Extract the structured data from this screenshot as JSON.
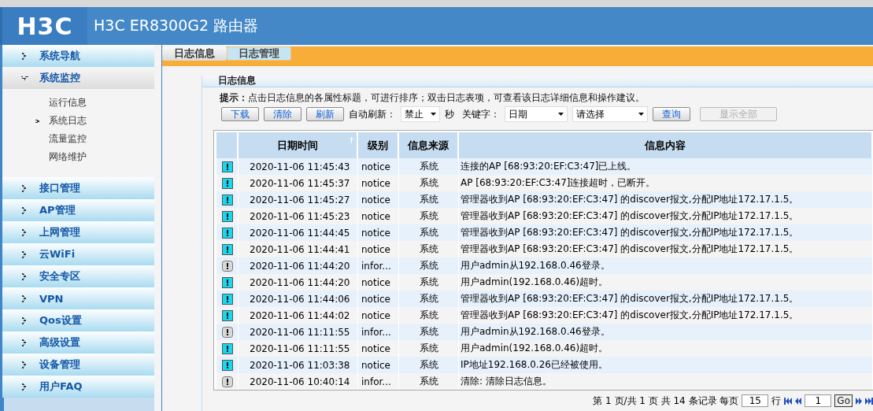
{
  "header": {
    "logo": "H3C",
    "title": "H3C ER8300G2 路由器"
  },
  "sidebar": {
    "items": [
      {
        "label": "系统导航",
        "expanded": false
      },
      {
        "label": "系统监控",
        "expanded": true,
        "children": [
          {
            "label": "运行信息",
            "selected": false
          },
          {
            "label": "系统日志",
            "selected": true
          },
          {
            "label": "流量监控",
            "selected": false
          },
          {
            "label": "网络维护",
            "selected": false
          }
        ]
      },
      {
        "label": "接口管理",
        "expanded": false
      },
      {
        "label": "AP管理",
        "expanded": false
      },
      {
        "label": "上网管理",
        "expanded": false
      },
      {
        "label": "云WiFi",
        "expanded": false
      },
      {
        "label": "安全专区",
        "expanded": false
      },
      {
        "label": "VPN",
        "expanded": false
      },
      {
        "label": "Qos设置",
        "expanded": false
      },
      {
        "label": "高级设置",
        "expanded": false
      },
      {
        "label": "设备管理",
        "expanded": false
      },
      {
        "label": "用户FAQ",
        "expanded": false
      }
    ]
  },
  "tabs": [
    {
      "label": "日志信息",
      "selected": true
    },
    {
      "label": "日志管理",
      "selected": false
    }
  ],
  "panel": {
    "title": "日志信息",
    "tip_label": "提示：",
    "tip": "点击日志信息的各属性标题，可进行排序；双击日志表项，可查看该日志详细信息和操作建议。",
    "buttons": [
      {
        "label": "下载",
        "disabled": false
      },
      {
        "label": "清除",
        "disabled": false
      },
      {
        "label": "刷新",
        "disabled": false
      }
    ],
    "auto_refresh_label": "自动刷新：",
    "auto_refresh_value": "禁止",
    "seconds_label": "秒",
    "keyword_label": "关键字：",
    "keyword_field": "日期",
    "keyword_value": "请选择",
    "query_buttons": [
      {
        "label": "查询",
        "disabled": false
      },
      {
        "label": "显示全部",
        "disabled": true
      }
    ]
  },
  "table": {
    "columns": [
      "日期时间",
      "级别",
      "信息来源",
      "信息内容"
    ],
    "rows": [
      {
        "kind": "notice",
        "time": "2020-11-06 11:45:43",
        "level": "notice",
        "source": "系统",
        "message": "连接的AP [68:93:20:EF:C3:47]已上线。"
      },
      {
        "kind": "notice",
        "time": "2020-11-06 11:45:37",
        "level": "notice",
        "source": "系统",
        "message": "AP [68:93:20:EF:C3:47]连接超时，已断开。"
      },
      {
        "kind": "notice",
        "time": "2020-11-06 11:45:27",
        "level": "notice",
        "source": "系统",
        "message": "管理器收到AP [68:93:20:EF:C3:47] 的discover报文,分配IP地址172.17.1.5。"
      },
      {
        "kind": "notice",
        "time": "2020-11-06 11:45:23",
        "level": "notice",
        "source": "系统",
        "message": "管理器收到AP [68:93:20:EF:C3:47] 的discover报文,分配IP地址172.17.1.5。"
      },
      {
        "kind": "notice",
        "time": "2020-11-06 11:44:45",
        "level": "notice",
        "source": "系统",
        "message": "管理器收到AP [68:93:20:EF:C3:47] 的discover报文,分配IP地址172.17.1.5。"
      },
      {
        "kind": "notice",
        "time": "2020-11-06 11:44:41",
        "level": "notice",
        "source": "系统",
        "message": "管理器收到AP [68:93:20:EF:C3:47] 的discover报文,分配IP地址172.17.1.5。"
      },
      {
        "kind": "info",
        "time": "2020-11-06 11:44:20",
        "level": "infor...",
        "source": "系统",
        "message": "用户admin从192.168.0.46登录。"
      },
      {
        "kind": "notice",
        "time": "2020-11-06 11:44:20",
        "level": "notice",
        "source": "系统",
        "message": "用户admin(192.168.0.46)超时。"
      },
      {
        "kind": "notice",
        "time": "2020-11-06 11:44:06",
        "level": "notice",
        "source": "系统",
        "message": "管理器收到AP [68:93:20:EF:C3:47] 的discover报文,分配IP地址172.17.1.5。"
      },
      {
        "kind": "notice",
        "time": "2020-11-06 11:44:02",
        "level": "notice",
        "source": "系统",
        "message": "管理器收到AP [68:93:20:EF:C3:47] 的discover报文,分配IP地址172.17.1.5。"
      },
      {
        "kind": "info",
        "time": "2020-11-06 11:11:55",
        "level": "infor...",
        "source": "系统",
        "message": "用户admin从192.168.0.46登录。"
      },
      {
        "kind": "notice",
        "time": "2020-11-06 11:11:55",
        "level": "notice",
        "source": "系统",
        "message": "用户admin(192.168.0.46)超时。"
      },
      {
        "kind": "notice",
        "time": "2020-11-06 11:03:38",
        "level": "notice",
        "source": "系统",
        "message": "IP地址192.168.0.26已经被使用。"
      },
      {
        "kind": "info",
        "time": "2020-11-06 10:40:14",
        "level": "infor...",
        "source": "系统",
        "message": "清除: 清除日志信息。"
      }
    ]
  },
  "pager": {
    "page_text": "第 1 页/共 1 页 共 14 条记录 每页",
    "per_page": "15",
    "rows_label": "行",
    "page": "1",
    "go": "Go"
  }
}
